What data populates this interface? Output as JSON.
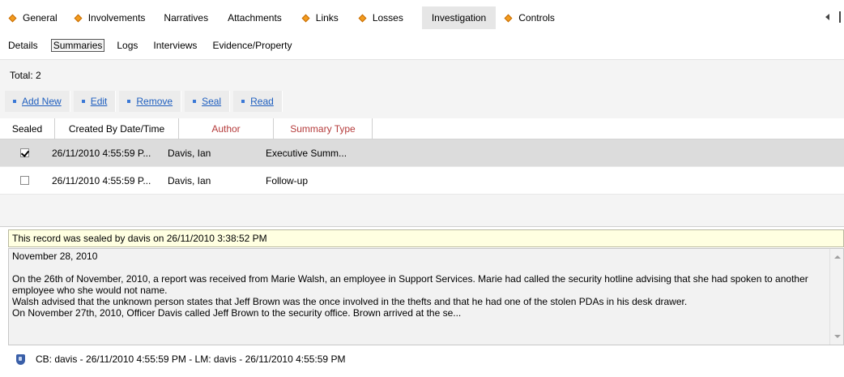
{
  "main_tabs": [
    {
      "label": "General",
      "icon": "diamond"
    },
    {
      "label": "Involvements",
      "icon": "diamond"
    },
    {
      "label": "Narratives",
      "icon": ""
    },
    {
      "label": "Attachments",
      "icon": ""
    },
    {
      "label": "Links",
      "icon": "diamond"
    },
    {
      "label": "Losses",
      "icon": "diamond"
    },
    {
      "label": "Investigation",
      "icon": "",
      "active": true
    },
    {
      "label": "Controls",
      "icon": "diamond"
    }
  ],
  "sub_tabs": [
    {
      "label": "Details"
    },
    {
      "label": "Summaries",
      "active": true
    },
    {
      "label": "Logs"
    },
    {
      "label": "Interviews"
    },
    {
      "label": "Evidence/Property"
    }
  ],
  "total": "Total: 2",
  "actions": [
    "Add New",
    "Edit",
    "Remove",
    "Seal",
    "Read"
  ],
  "grid": {
    "headers": [
      "Sealed",
      "Created By Date/Time",
      "Author",
      "Summary Type"
    ],
    "rows": [
      {
        "sealed": true,
        "created": "26/11/2010  4:55:59 P...",
        "author": "Davis, Ian",
        "type": "Executive Summ..."
      },
      {
        "sealed": false,
        "created": "26/11/2010  4:55:59 P...",
        "author": "Davis, Ian",
        "type": "Follow-up"
      }
    ]
  },
  "sealed_note": "This record was sealed by davis on 26/11/2010 3:38:52 PM",
  "summary": {
    "date_line": "November 28, 2010",
    "para1": "On the 26th of November, 2010, a report was received from Marie Walsh, an employee in Support Services. Marie had called the security hotline advising that she had spoken to another employee who she would not name.",
    "para2": "Walsh advised that the unknown person states that Jeff Brown was the once involved in the thefts and that he had one of the stolen PDAs in his desk drawer.",
    "para3": "On November 27th, 2010, Officer Davis called Jeff Brown to the security office. Brown arrived at the se..."
  },
  "footer": "CB: davis - 26/11/2010 4:55:59 PM - LM: davis - 26/11/2010 4:55:59 PM",
  "colors": {
    "accent_diamond": "#f39c1f",
    "link": "#1f5fbf",
    "header_red": "#b53c3c",
    "note_bg": "#ffffe1"
  }
}
